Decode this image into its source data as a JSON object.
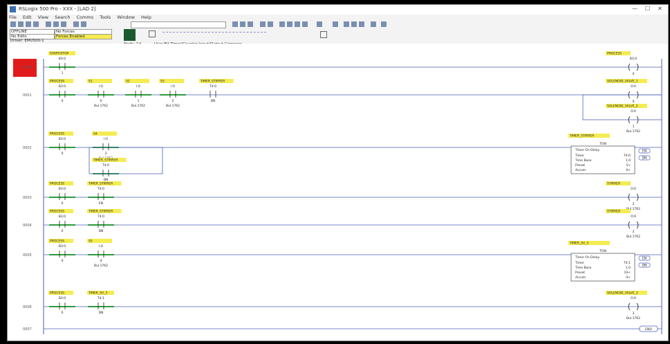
{
  "window": {
    "title": "RSLogix 500 Pro - XXX - [LAD 2]",
    "controls": [
      "—",
      "☐",
      "✕"
    ]
  },
  "menu": [
    "File",
    "Edit",
    "View",
    "Search",
    "Comms",
    "Tools",
    "Window",
    "Help"
  ],
  "status": {
    "mode": "OFFLINE",
    "forces": "No Forces",
    "edits": "No Edits",
    "forces_enabled": "Forces Enabled",
    "driver": "Driver: EMU500-1",
    "node": "Node: 1d"
  },
  "instruction_tabs": [
    "User",
    "Bit",
    "Timer/Counter",
    "Input/Output",
    "Compare"
  ],
  "colors": {
    "rung_active": "#2a9d3a",
    "label_bg": "#f5ec52",
    "rail": "#4a5fb8",
    "status_red": "#e11b1b"
  },
  "rungs": [
    {
      "num": "0000",
      "contacts": [
        {
          "tag": "START/STOP",
          "addr": "B3:0",
          "bit": "1"
        }
      ],
      "outputs": [
        {
          "tag": "PROCESS",
          "addr": "B3:0",
          "bit": "0"
        }
      ]
    },
    {
      "num": "0001",
      "contacts": [
        {
          "tag": "PROCESS",
          "addr": "B3:0",
          "bit": "0"
        },
        {
          "tag": "S1",
          "addr": "I:0",
          "bit": "0",
          "sub": "Bul.1762"
        },
        {
          "tag": "S2",
          "addr": "I:0",
          "bit": "1",
          "sub": "Bul.1762"
        },
        {
          "tag": "S3",
          "addr": "I:0",
          "bit": "2",
          "sub": "Bul.1762"
        },
        {
          "tag": "TIMER_STIRRER",
          "addr": "T4:0",
          "bit": "DN"
        }
      ],
      "outputs": [
        {
          "tag": "SOLENOID_VALVE_1",
          "addr": "O:0",
          "bit": "0",
          "sub": "Bul.1762"
        },
        {
          "tag": "SOLENOID_VALVE_2",
          "addr": "O:0",
          "bit": "1",
          "sub": "Bul.1762"
        }
      ]
    },
    {
      "num": "0002",
      "contacts": [
        {
          "tag": "PROCESS",
          "addr": "B3:0",
          "bit": "0"
        },
        {
          "tag": "S4",
          "addr": "I:0",
          "bit": "3",
          "sub": "Bul.1762"
        },
        {
          "tag": "TIMER_STIRRER",
          "addr": "T4:0",
          "bit": "DN"
        }
      ],
      "timer": {
        "tag": "TIMER_STIRRER",
        "type": "TON",
        "title": "Timer On Delay",
        "rows": [
          {
            "k": "Timer",
            "v": "T4:0"
          },
          {
            "k": "Time Base",
            "v": "1.0"
          },
          {
            "k": "Preset",
            "v": "5<"
          },
          {
            "k": "Accum",
            "v": "0<"
          }
        ],
        "en": "EN",
        "dn": "DN"
      }
    },
    {
      "num": "0003",
      "contacts": [
        {
          "tag": "PROCESS",
          "addr": "B3:0",
          "bit": "0"
        },
        {
          "tag": "TIMER_STIRRER",
          "addr": "T4:0",
          "bit": "EN"
        }
      ],
      "outputs": [
        {
          "tag": "STIRRER",
          "addr": "O:0",
          "bit": "2",
          "sub": "Bul.1762"
        }
      ]
    },
    {
      "num": "0004",
      "contacts": [
        {
          "tag": "PROCESS",
          "addr": "B3:0",
          "bit": "0"
        },
        {
          "tag": "TIMER_STIRRER",
          "addr": "T4:0",
          "bit": "DN"
        }
      ],
      "outputs": [
        {
          "tag": "STIRRER",
          "addr": "O:0",
          "bit": "2",
          "sub": "Bul.1762"
        }
      ]
    },
    {
      "num": "0005",
      "contacts": [
        {
          "tag": "PROCESS",
          "addr": "B3:0",
          "bit": "0"
        },
        {
          "tag": "S5",
          "addr": "I:0",
          "bit": "4",
          "sub": "Bul.1762"
        }
      ],
      "timer": {
        "tag": "TIMER_SV_3",
        "type": "TON",
        "title": "Timer On Delay",
        "rows": [
          {
            "k": "Timer",
            "v": "T4:1"
          },
          {
            "k": "Time Base",
            "v": "1.0"
          },
          {
            "k": "Preset",
            "v": "10<"
          },
          {
            "k": "Accum",
            "v": "0<"
          }
        ],
        "en": "EN",
        "dn": "DN"
      }
    },
    {
      "num": "0006",
      "contacts": [
        {
          "tag": "PROCESS",
          "addr": "B3:0",
          "bit": "0"
        },
        {
          "tag": "TIMER_SV_3",
          "addr": "T4:1",
          "bit": "DN"
        }
      ],
      "outputs": [
        {
          "tag": "SOLENOID_VALVE_3",
          "addr": "O:0",
          "bit": "3",
          "sub": "Bul.1762"
        }
      ]
    },
    {
      "num": "0007",
      "end": "END"
    }
  ]
}
